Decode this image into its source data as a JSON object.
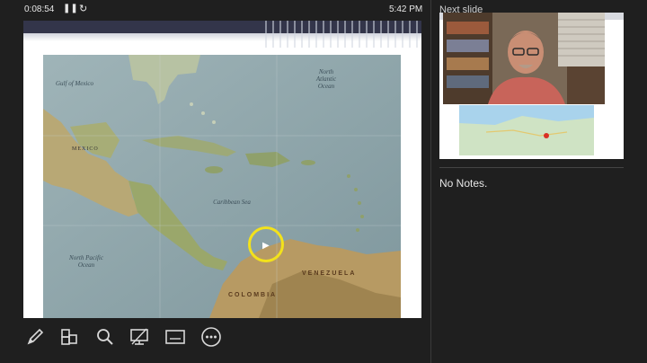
{
  "topbar": {
    "timer": "0:08:54",
    "pause_icon": "pause-icon",
    "reset_icon": "reset-icon",
    "clock": "5:42 PM"
  },
  "slide": {
    "map_labels": {
      "gulf_of_mexico": "Gulf of Mexico",
      "north_atlantic": "North Atlantic Ocean",
      "caribbean_sea": "Caribbean Sea",
      "north_pacific": "North Pacific Ocean",
      "mexico": "MEXICO",
      "venezuela": "VENEZUELA",
      "colombia": "COLOMBIA"
    }
  },
  "next_slide": {
    "label": "Next slide"
  },
  "notes": {
    "text": "No Notes."
  },
  "toolbar": {
    "items": [
      {
        "name": "pen-tool-icon"
      },
      {
        "name": "see-all-slides-icon"
      },
      {
        "name": "zoom-icon"
      },
      {
        "name": "black-screen-icon"
      },
      {
        "name": "subtitles-icon"
      },
      {
        "name": "more-options-icon"
      }
    ]
  },
  "colors": {
    "background": "#1f1f1f",
    "laser_pointer": "#f3e21b",
    "text": "#e6e6e6"
  }
}
